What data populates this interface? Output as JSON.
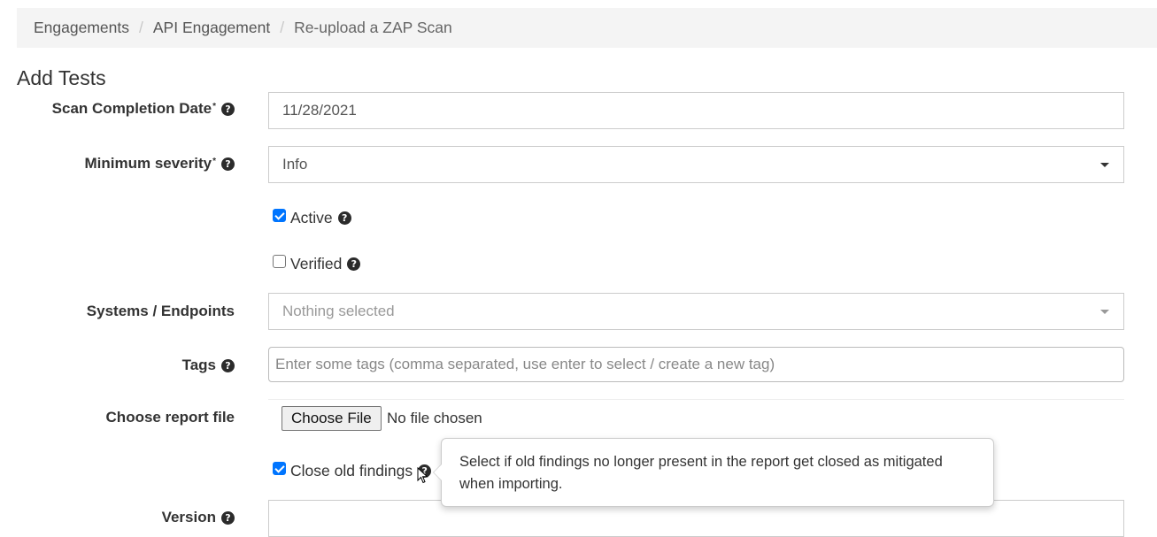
{
  "breadcrumb": {
    "items": [
      "Engagements",
      "API Engagement",
      "Re-upload a ZAP Scan"
    ],
    "separator": "/"
  },
  "page_title": "Add Tests",
  "form": {
    "scan_date": {
      "label": "Scan Completion Date",
      "required_mark": "*",
      "value": "11/28/2021"
    },
    "min_severity": {
      "label": "Minimum severity",
      "required_mark": "*",
      "value": "Info"
    },
    "active": {
      "label": "Active",
      "checked": true
    },
    "verified": {
      "label": "Verified",
      "checked": false
    },
    "endpoints": {
      "label": "Systems / Endpoints",
      "placeholder": "Nothing selected"
    },
    "tags": {
      "label": "Tags",
      "placeholder": "Enter some tags (comma separated, use enter to select / create a new tag)"
    },
    "report_file": {
      "label": "Choose report file",
      "button_label": "Choose File",
      "status": "No file chosen"
    },
    "close_old_findings": {
      "label": "Close old findings",
      "checked": true
    },
    "version": {
      "label": "Version"
    }
  },
  "tooltip": {
    "text": "Select if old findings no longer present in the report get closed as mitigated when importing."
  },
  "icons": {
    "help": "question-circle-icon",
    "caret": "caret-down-icon",
    "cursor": "mouse-pointer-icon"
  },
  "colors": {
    "checkbox_accent": "#0075ff",
    "breadcrumb_bg": "#f4f4f4"
  },
  "help_glyph": "?"
}
